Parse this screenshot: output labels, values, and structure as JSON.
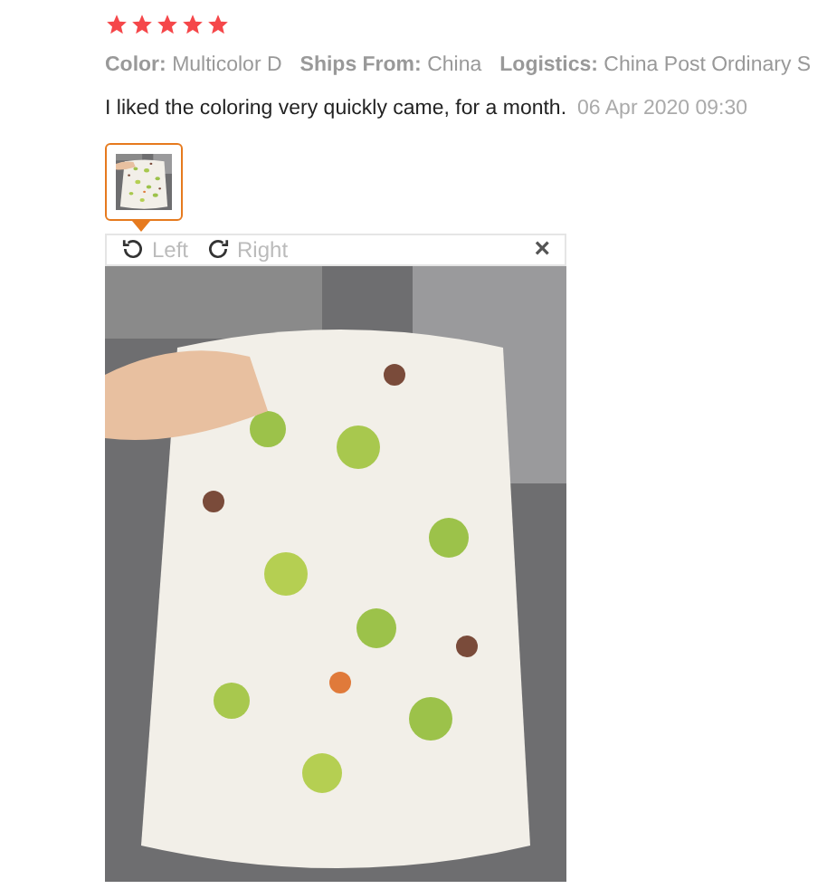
{
  "review": {
    "stars": 5,
    "attributes": [
      {
        "label": "Color:",
        "value": "Multicolor D"
      },
      {
        "label": "Ships From:",
        "value": "China"
      },
      {
        "label": "Logistics:",
        "value": "China Post Ordinary S"
      }
    ],
    "text": "I liked the coloring very quickly came, for a month.",
    "date": "06 Apr 2020 09:30",
    "thumbnails": [
      {
        "selected": true
      }
    ],
    "viewer": {
      "rotate_left": "Left",
      "rotate_right": "Right",
      "close": "×"
    }
  }
}
